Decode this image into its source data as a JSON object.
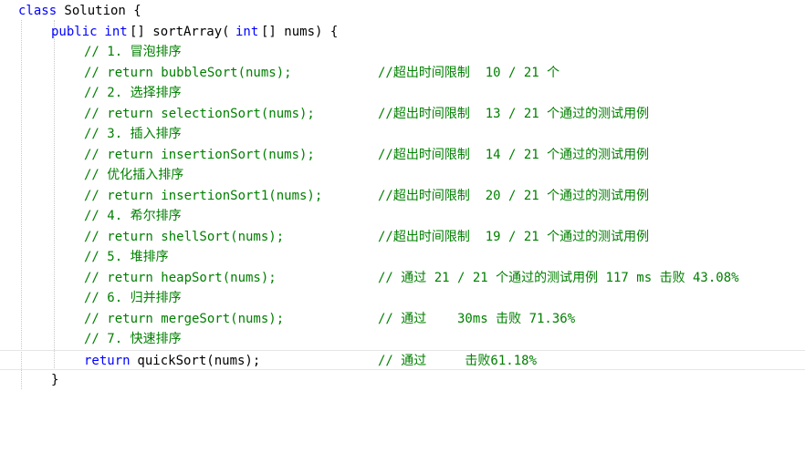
{
  "code": {
    "line1": {
      "kw": "class",
      "name": " Solution {"
    },
    "line2": {
      "kw1": "public",
      "type1": " int",
      "rest1": "[] sortArray(",
      "type2": "int",
      "rest2": "[] nums) {"
    },
    "line3": {
      "comment": "// 1. 冒泡排序"
    },
    "line4": {
      "code": "// return bubbleSort(nums);",
      "note": "//超出时间限制  10 / 21 个"
    },
    "line5": {
      "comment": "// 2. 选择排序"
    },
    "line6": {
      "code": "// return selectionSort(nums);",
      "note": "//超出时间限制  13 / 21 个通过的测试用例"
    },
    "line7": {
      "comment": "// 3. 插入排序"
    },
    "line8": {
      "code": "// return insertionSort(nums);",
      "note": "//超出时间限制  14 / 21 个通过的测试用例"
    },
    "line9": {
      "comment": "// 优化插入排序"
    },
    "line10": {
      "code": "// return insertionSort1(nums);",
      "note": "//超出时间限制  20 / 21 个通过的测试用例"
    },
    "line11": {
      "comment": "// 4. 希尔排序"
    },
    "line12": {
      "code": "// return shellSort(nums);",
      "note": "//超出时间限制  19 / 21 个通过的测试用例"
    },
    "line13": {
      "comment": "// 5. 堆排序"
    },
    "line14": {
      "code": "// return heapSort(nums);",
      "note": "// 通过 21 / 21 个通过的测试用例 117 ms 击败 43.08%"
    },
    "line15": {
      "comment": "// 6. 归并排序"
    },
    "line16": {
      "code": "// return mergeSort(nums);",
      "note": "// 通过    30ms 击败 71.36%"
    },
    "line17": {
      "comment": "// 7. 快速排序"
    },
    "line18": {
      "kw": "return",
      "call": " quickSort(nums);",
      "note": "// 通过     击败61.18%"
    },
    "line19": {
      "brace": "}"
    }
  }
}
